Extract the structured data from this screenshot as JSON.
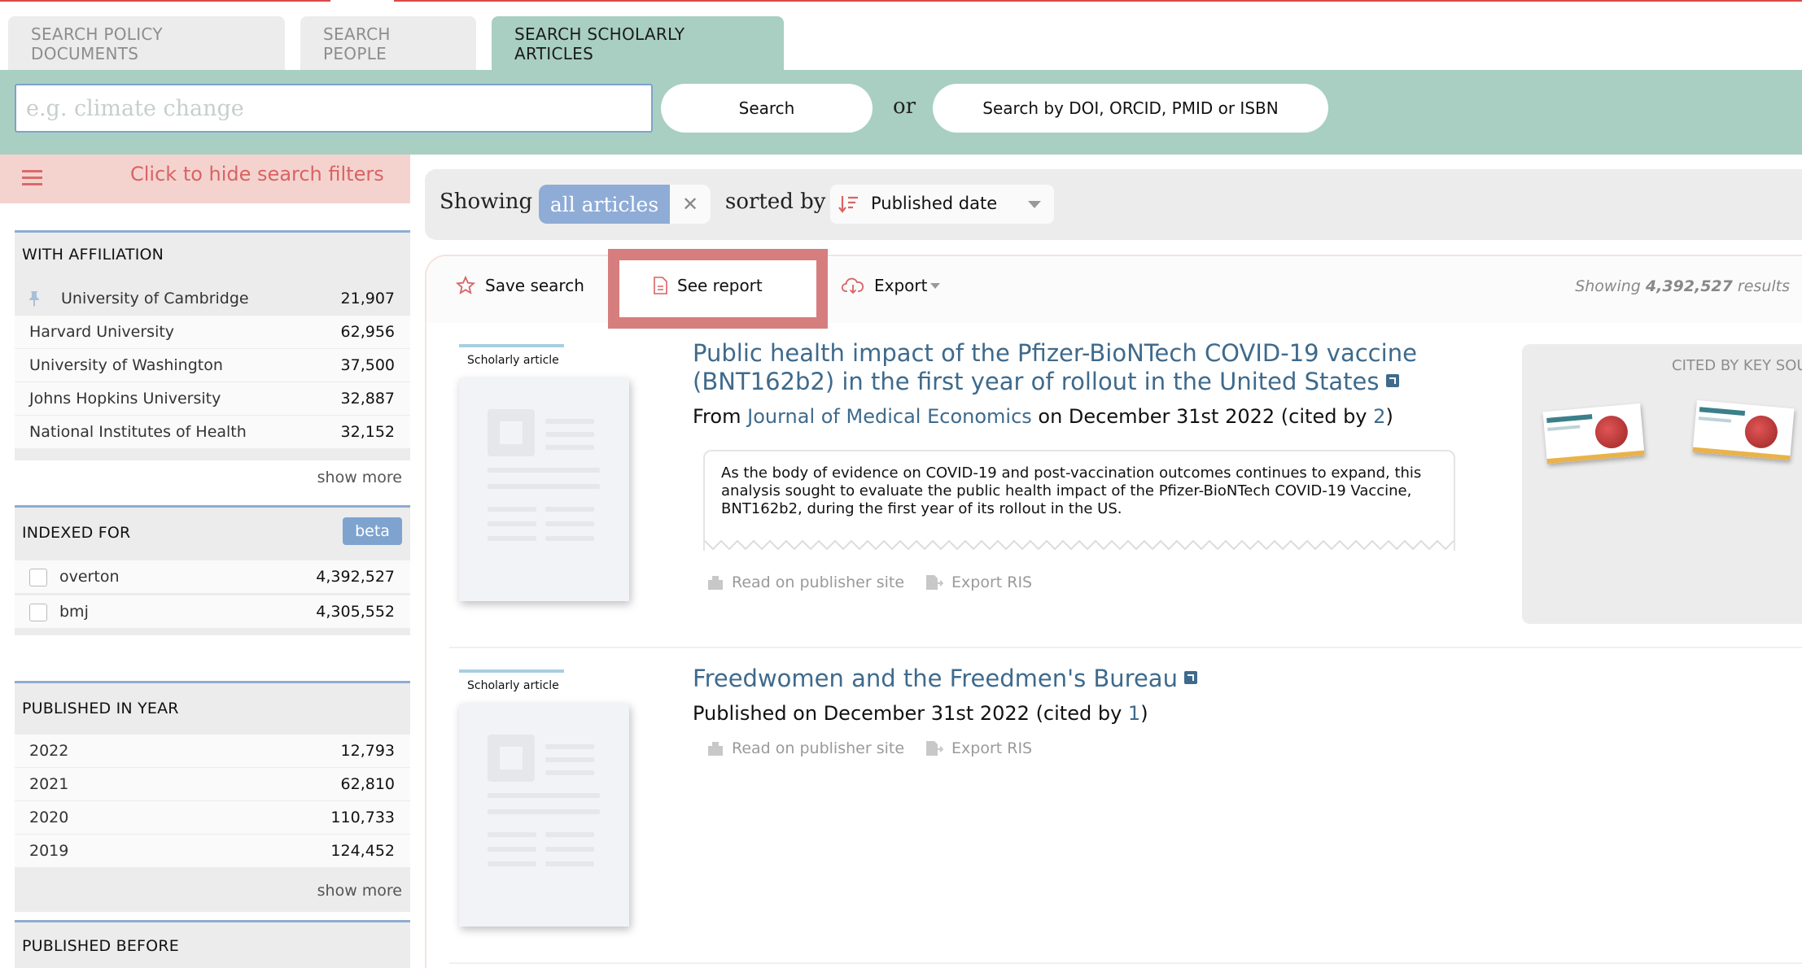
{
  "tabs": [
    {
      "label": "SEARCH POLICY DOCUMENTS"
    },
    {
      "label": "SEARCH PEOPLE"
    },
    {
      "label": "SEARCH SCHOLARLY ARTICLES"
    }
  ],
  "search": {
    "placeholder": "e.g. climate change",
    "search_label": "Search",
    "or_text": "or",
    "doi_label": "Search by DOI, ORCID, PMID or ISBN"
  },
  "sidebar": {
    "hide_filters_label": "Click to hide search filters",
    "affiliation": {
      "title": "WITH AFFILIATION",
      "items": [
        {
          "name": "University of Cambridge",
          "count": "21,907",
          "pinned": true
        },
        {
          "name": "Harvard University",
          "count": "62,956"
        },
        {
          "name": "University of Washington",
          "count": "37,500"
        },
        {
          "name": "Johns Hopkins University",
          "count": "32,887"
        },
        {
          "name": "National Institutes of Health",
          "count": "32,152"
        }
      ],
      "show_more": "show more"
    },
    "indexed": {
      "title": "INDEXED FOR",
      "badge": "beta",
      "items": [
        {
          "name": "overton",
          "count": "4,392,527"
        },
        {
          "name": "bmj",
          "count": "4,305,552"
        }
      ]
    },
    "year": {
      "title": "PUBLISHED IN YEAR",
      "items": [
        {
          "name": "2022",
          "count": "12,793"
        },
        {
          "name": "2021",
          "count": "62,810"
        },
        {
          "name": "2020",
          "count": "110,733"
        },
        {
          "name": "2019",
          "count": "124,452"
        }
      ],
      "show_more": "show more"
    },
    "before": {
      "title": "PUBLISHED BEFORE"
    }
  },
  "showbar": {
    "showing": "Showing",
    "chip": "all articles",
    "chip_close": "✕",
    "sorted_by": "sorted by",
    "sort_value": "Published date"
  },
  "toolbar": {
    "save_search": "Save search",
    "see_report": "See report",
    "export": "Export",
    "result_prefix": "Showing",
    "result_count": "4,392,527",
    "result_suffix": "results"
  },
  "results": [
    {
      "type": "Scholarly article",
      "title": "Public health impact of the Pfizer-BioNTech COVID-19 vaccine (BNT162b2) in the first year of rollout in the United States",
      "meta_from": "From",
      "journal": "Journal of Medical Economics",
      "meta_on": "on December 31st 2022 (cited by",
      "cited": "2",
      "meta_end": ")",
      "abstract": "As the body of evidence on COVID-19 and post-vaccination outcomes continues to expand, this analysis sought to evaluate the public health impact of the Pfizer-BioNTech COVID-19 Vaccine, BNT162b2, during the first year of its rollout in the US.",
      "read_label": "Read on publisher site",
      "export_label": "Export RIS",
      "cited_by_title": "CITED BY KEY SOURCES"
    },
    {
      "type": "Scholarly article",
      "title": "Freedwomen and the Freedmen's Bureau",
      "meta_on": "Published on December 31st 2022 (cited by",
      "cited": "1",
      "meta_end": ")",
      "read_label": "Read on publisher site",
      "export_label": "Export RIS"
    }
  ],
  "colors": {
    "accent_green": "#a8cfc2",
    "link_blue": "#3e6a8c",
    "highlight_red": "#d67d7e"
  }
}
